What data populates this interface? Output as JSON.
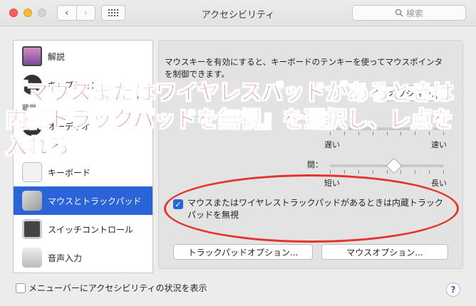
{
  "window": {
    "title": "アクセシビリティ",
    "search_placeholder": "検索",
    "back_glyph": "‹",
    "forward_glyph": "›"
  },
  "sidebar": {
    "items": [
      {
        "label": "解説",
        "icon": "display-icon"
      },
      {
        "label": "キャプション",
        "icon": "caption-icon"
      },
      {
        "label": "オーディオ",
        "icon": "audio-icon"
      },
      {
        "label": "キーボード",
        "icon": "keyboard-icon"
      },
      {
        "label": "マウスとトラックパッド",
        "icon": "mouse-icon",
        "selected": true
      },
      {
        "label": "スイッチコントロール",
        "icon": "switch-icon"
      },
      {
        "label": "音声入力",
        "icon": "microphone-icon"
      }
    ],
    "header_hearing": "聴覚"
  },
  "main": {
    "description": "マウスキーを有効にすると、キーボードのテンキーを使ってマウスポインタを制御できます。",
    "option_button": "オプション...",
    "slider1": {
      "min_label": "遅い",
      "max_label": "速い"
    },
    "slider2": {
      "label_fragment": "間：",
      "min_label": "短い",
      "max_label": "長い",
      "value": 0.56
    },
    "ignore_trackpad": {
      "checked": true,
      "label": "マウスまたはワイヤレストラックパッドがあるときは内蔵トラックパッドを無視"
    },
    "trackpad_options_button": "トラックパッドオプション...",
    "mouse_options_button": "マウスオプション..."
  },
  "annotation": {
    "text": "『マウスまたはワイヤレスパッドがあるときは内臓トラックパッドを無視』を選択し、レ点を入れる。",
    "color": "#e3342f"
  },
  "footer": {
    "menubar_checkbox_label": "メニューバーにアクセシビリティの状況を表示",
    "menubar_checked": false,
    "help_label": "?"
  },
  "colors": {
    "accent": "#2b63d8",
    "annotation": "#e3342f"
  }
}
